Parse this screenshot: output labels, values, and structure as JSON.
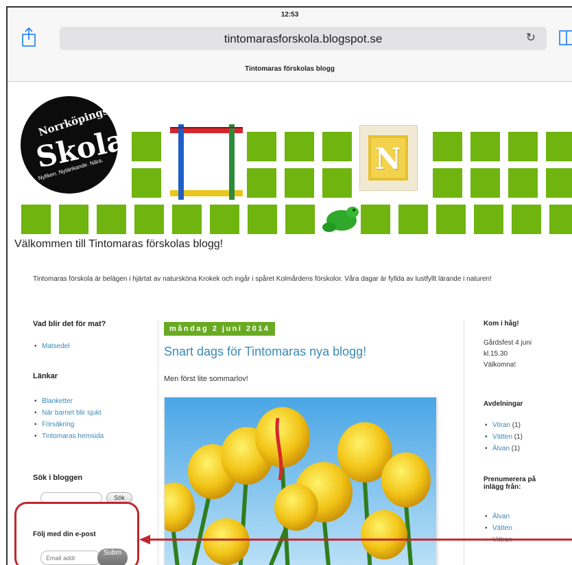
{
  "status_bar": {
    "time": "12:53"
  },
  "browser": {
    "url": "tintomarasforskola.blogspot.se",
    "tab_title": "Tintomaras förskolas blogg"
  },
  "logo": {
    "line1": "Norrköpings",
    "line2": "Skola",
    "tagline": "Nyfiken. Nytänkande. Nära."
  },
  "banner": {
    "block_letter": "N"
  },
  "header": {
    "welcome": "Välkommen till Tintomaras förskolas blogg!",
    "intro": "Tintomaras förskola är belägen i hjärtat av natursköna Krokek och ingår i spåret Kolmårdens förskolor. Våra dagar är fyllda av lustfyllt lärande i naturen!"
  },
  "left_sidebar": {
    "food_heading": "Vad blir det för mat?",
    "food_links": [
      "Matsedel"
    ],
    "links_heading": "Länkar",
    "links": [
      "Blanketter",
      "När barnet blir sjukt",
      "Försäkring",
      "Tintomaras hemsida"
    ],
    "search_heading": "Sök i bloggen",
    "search_button": "Sök",
    "follow_heading": "Följ med din e-post",
    "email_placeholder": "Email addr",
    "submit_button": "Subm"
  },
  "post": {
    "date": "måndag 2 juni 2014",
    "title": "Snart dags för Tintomaras nya blogg!",
    "body": "Men först lite sommarlov!"
  },
  "right_sidebar": {
    "remember_heading": "Kom i håg!",
    "remember_lines": [
      "Gårdsfest 4 juni",
      "kl.15.30",
      "Välkomna!"
    ],
    "departments_heading": "Avdelningar",
    "departments": [
      {
        "name": "Vitran",
        "count": "(1)"
      },
      {
        "name": "Vätten",
        "count": "(1)"
      },
      {
        "name": "Älvan",
        "count": "(1)"
      }
    ],
    "subscribe_heading_1": "Prenumerera på",
    "subscribe_heading_2": "inlägg från:",
    "subscribe": [
      "Älvan",
      "Vätten",
      "Vittran"
    ]
  },
  "colors": {
    "accent_green": "#6fb40f",
    "link_blue": "#3a88b8",
    "annotation_red": "#c0262b"
  }
}
